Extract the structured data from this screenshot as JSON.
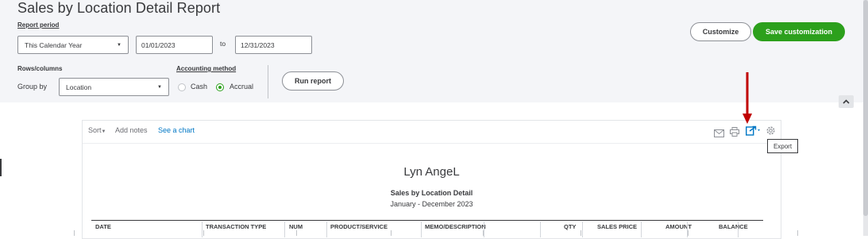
{
  "page": {
    "title": "Sales by Location Detail Report"
  },
  "filters": {
    "report_period_label": "Report period",
    "period_value": "This Calendar Year",
    "start_date": "01/01/2023",
    "to_label": "to",
    "end_date": "12/31/2023",
    "rows_columns_label": "Rows/columns",
    "group_by_label": "Group by",
    "group_by_value": "Location",
    "accounting_method_label": "Accounting method",
    "cash_label": "Cash",
    "accrual_label": "Accrual",
    "selected_method": "Accrual",
    "run_report_label": "Run report"
  },
  "actions": {
    "customize_label": "Customize",
    "save_customization_label": "Save customization"
  },
  "report_toolbar": {
    "sort_label": "Sort",
    "add_notes_label": "Add notes",
    "see_chart_label": "See a chart",
    "icons": [
      "email-icon",
      "print-icon",
      "export-icon",
      "settings-icon"
    ],
    "export_tooltip": "Export"
  },
  "report": {
    "company_name": "Lyn AngeL",
    "report_name": "Sales by Location Detail",
    "date_range": "January - December 2023",
    "columns": [
      "DATE",
      "TRANSACTION TYPE",
      "NUM",
      "PRODUCT/SERVICE",
      "MEMO/DESCRIPTION",
      "QTY",
      "SALES PRICE",
      "AMOUNT",
      "BALANCE"
    ]
  },
  "colors": {
    "accent_green": "#2ca01c",
    "link_blue": "#0077c5",
    "annotation_arrow": "#c00000",
    "panel_bg": "#f4f5f8"
  }
}
